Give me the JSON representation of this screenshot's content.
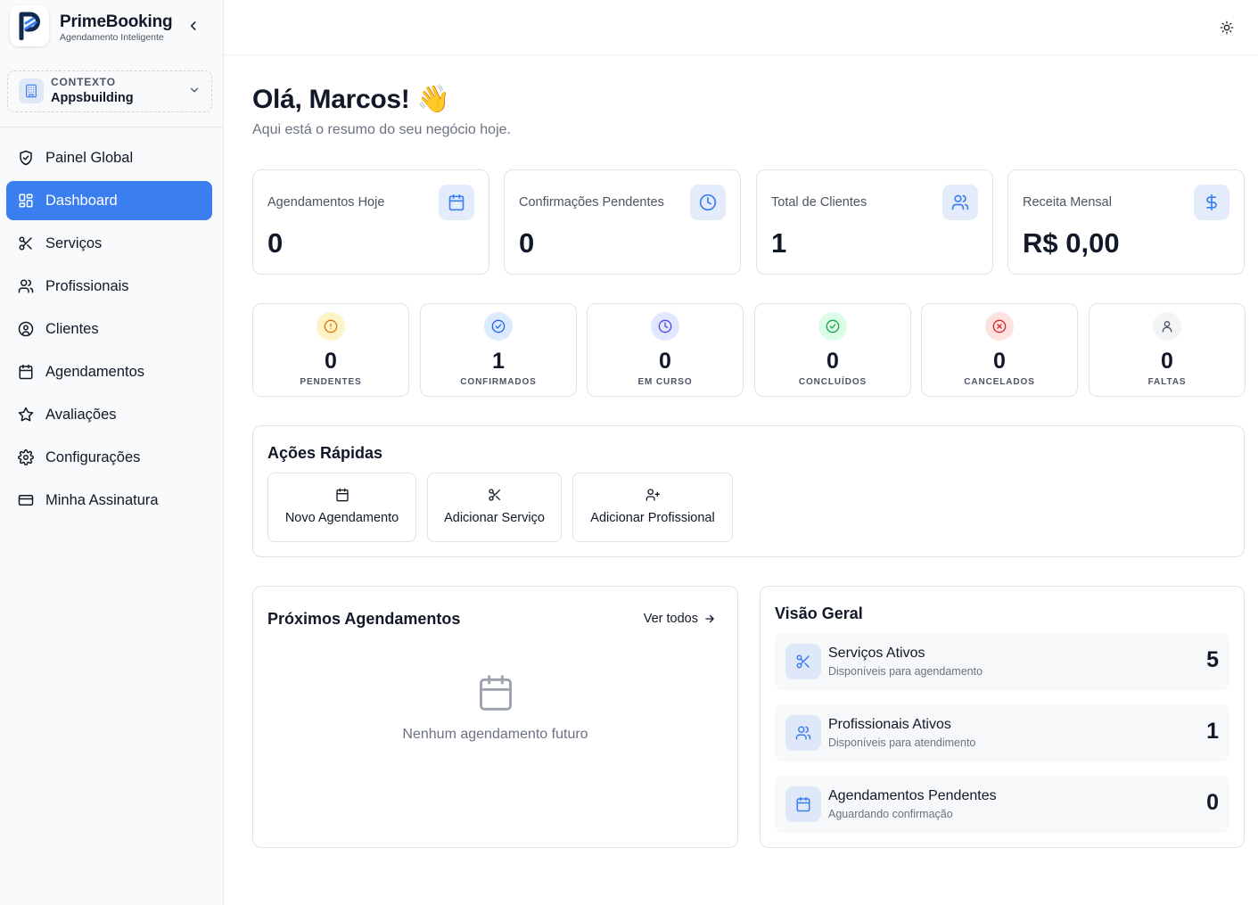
{
  "app": {
    "name": "PrimeBooking",
    "tagline": "Agendamento Inteligente"
  },
  "context": {
    "label": "CONTEXTO",
    "value": "Appsbuilding"
  },
  "nav": {
    "items": [
      {
        "label": "Painel Global",
        "icon": "shield-check-icon"
      },
      {
        "label": "Dashboard",
        "icon": "grid-icon",
        "active": true
      },
      {
        "label": "Serviços",
        "icon": "scissors-icon"
      },
      {
        "label": "Profissionais",
        "icon": "users-icon"
      },
      {
        "label": "Clientes",
        "icon": "user-circle-icon"
      },
      {
        "label": "Agendamentos",
        "icon": "calendar-icon"
      },
      {
        "label": "Avaliações",
        "icon": "star-icon"
      },
      {
        "label": "Configurações",
        "icon": "gear-icon"
      },
      {
        "label": "Minha Assinatura",
        "icon": "credit-card-icon"
      }
    ]
  },
  "greeting": {
    "title": "Olá, Marcos! 👋",
    "subtitle": "Aqui está o resumo do seu negócio hoje."
  },
  "stats": [
    {
      "label": "Agendamentos Hoje",
      "value": "0",
      "icon": "calendar-icon"
    },
    {
      "label": "Confirmações Pendentes",
      "value": "0",
      "icon": "clock-icon"
    },
    {
      "label": "Total de Clientes",
      "value": "1",
      "icon": "users-icon"
    },
    {
      "label": "Receita Mensal",
      "value": "R$ 0,00",
      "icon": "dollar-icon"
    }
  ],
  "statuses": [
    {
      "label": "PENDENTES",
      "value": "0",
      "icon": "alert-circle-icon",
      "color": "#d97706",
      "bg": "#fef3c7"
    },
    {
      "label": "CONFIRMADOS",
      "value": "1",
      "icon": "check-circle-icon",
      "color": "#2563eb",
      "bg": "#dbeafe"
    },
    {
      "label": "EM CURSO",
      "value": "0",
      "icon": "clock-icon",
      "color": "#4f46e5",
      "bg": "#e0e7ff"
    },
    {
      "label": "CONCLUÍDOS",
      "value": "0",
      "icon": "check-circle-icon",
      "color": "#16a34a",
      "bg": "#dcfce7"
    },
    {
      "label": "CANCELADOS",
      "value": "0",
      "icon": "x-circle-icon",
      "color": "#dc2626",
      "bg": "#fee2e2"
    },
    {
      "label": "FALTAS",
      "value": "0",
      "icon": "user-icon",
      "color": "#4b5563",
      "bg": "#f3f4f6"
    }
  ],
  "quick_actions": {
    "title": "Ações Rápidas",
    "items": [
      {
        "label": "Novo Agendamento",
        "icon": "calendar-icon"
      },
      {
        "label": "Adicionar Serviço",
        "icon": "scissors-icon"
      },
      {
        "label": "Adicionar Profissional",
        "icon": "user-plus-icon"
      }
    ]
  },
  "upcoming": {
    "title": "Próximos Agendamentos",
    "link": "Ver todos",
    "empty": "Nenhum agendamento futuro"
  },
  "overview": {
    "title": "Visão Geral",
    "rows": [
      {
        "title": "Serviços Ativos",
        "subtitle": "Disponíveis para agendamento",
        "value": "5",
        "icon": "scissors-icon"
      },
      {
        "title": "Profissionais Ativos",
        "subtitle": "Disponíveis para atendimento",
        "value": "1",
        "icon": "users-icon"
      },
      {
        "title": "Agendamentos Pendentes",
        "subtitle": "Aguardando confirmação",
        "value": "0",
        "icon": "calendar-icon"
      }
    ]
  },
  "colors": {
    "accent": "#3b7ef0",
    "icon_blue": "#3b7ef0"
  }
}
